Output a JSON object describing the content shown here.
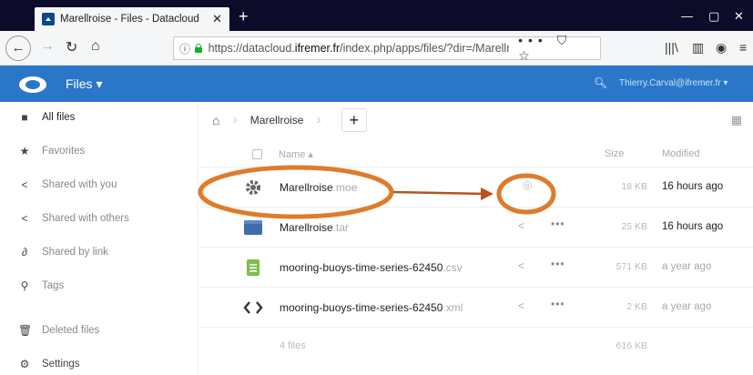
{
  "browser": {
    "tab_title": "Marellroise - Files - Datacloud",
    "tab_close": "✕",
    "new_tab": "+",
    "window_controls": [
      "—",
      "▢",
      "✕"
    ],
    "url_prefix": "https://datacloud.",
    "url_domain": "ifremer.fr",
    "url_rest": "/index.php/apps/files/?dir=/Marellroi",
    "url_actions": "••• ⛉ ☆"
  },
  "app": {
    "name": "Files ▾",
    "user": "Thierry.Carval@ifremer.fr ▾",
    "brand_color": "#2a77c9"
  },
  "sidebar": {
    "items": [
      {
        "label": "All files",
        "icon": "folder-icon"
      },
      {
        "label": "Favorites",
        "icon": "star-icon"
      },
      {
        "label": "Shared with you",
        "icon": "share-icon"
      },
      {
        "label": "Shared with others",
        "icon": "share-icon"
      },
      {
        "label": "Shared by link",
        "icon": "link-icon"
      },
      {
        "label": "Tags",
        "icon": "tag-icon"
      },
      {
        "label": "Deleted files",
        "icon": "trash-icon"
      },
      {
        "label": "Settings",
        "icon": "gear-icon"
      }
    ]
  },
  "breadcrumb": {
    "folder": "Marellroise",
    "new_label": "+"
  },
  "table": {
    "headers": {
      "name": "Name ▴",
      "size": "Size",
      "modified": "Modified"
    },
    "rows": [
      {
        "name": "Marellroise",
        "ext": ".moe",
        "size": "18 KB",
        "modified": "16 hours ago",
        "icon": "gear-icon"
      },
      {
        "name": "Marellroise",
        "ext": ".tar",
        "size": "25 KB",
        "modified": "16 hours ago",
        "icon": "archive-icon"
      },
      {
        "name": "mooring-buoys-time-series-62450",
        "ext": ".csv",
        "size": "571 KB",
        "modified": "a year ago",
        "icon": "spreadsheet-icon"
      },
      {
        "name": "mooring-buoys-time-series-62450",
        "ext": ".xml",
        "size": "2 KB",
        "modified": "a year ago",
        "icon": "code-icon"
      }
    ],
    "summary_count": "4 files",
    "summary_size": "616 KB"
  },
  "annotation_color": "#e07b2a"
}
